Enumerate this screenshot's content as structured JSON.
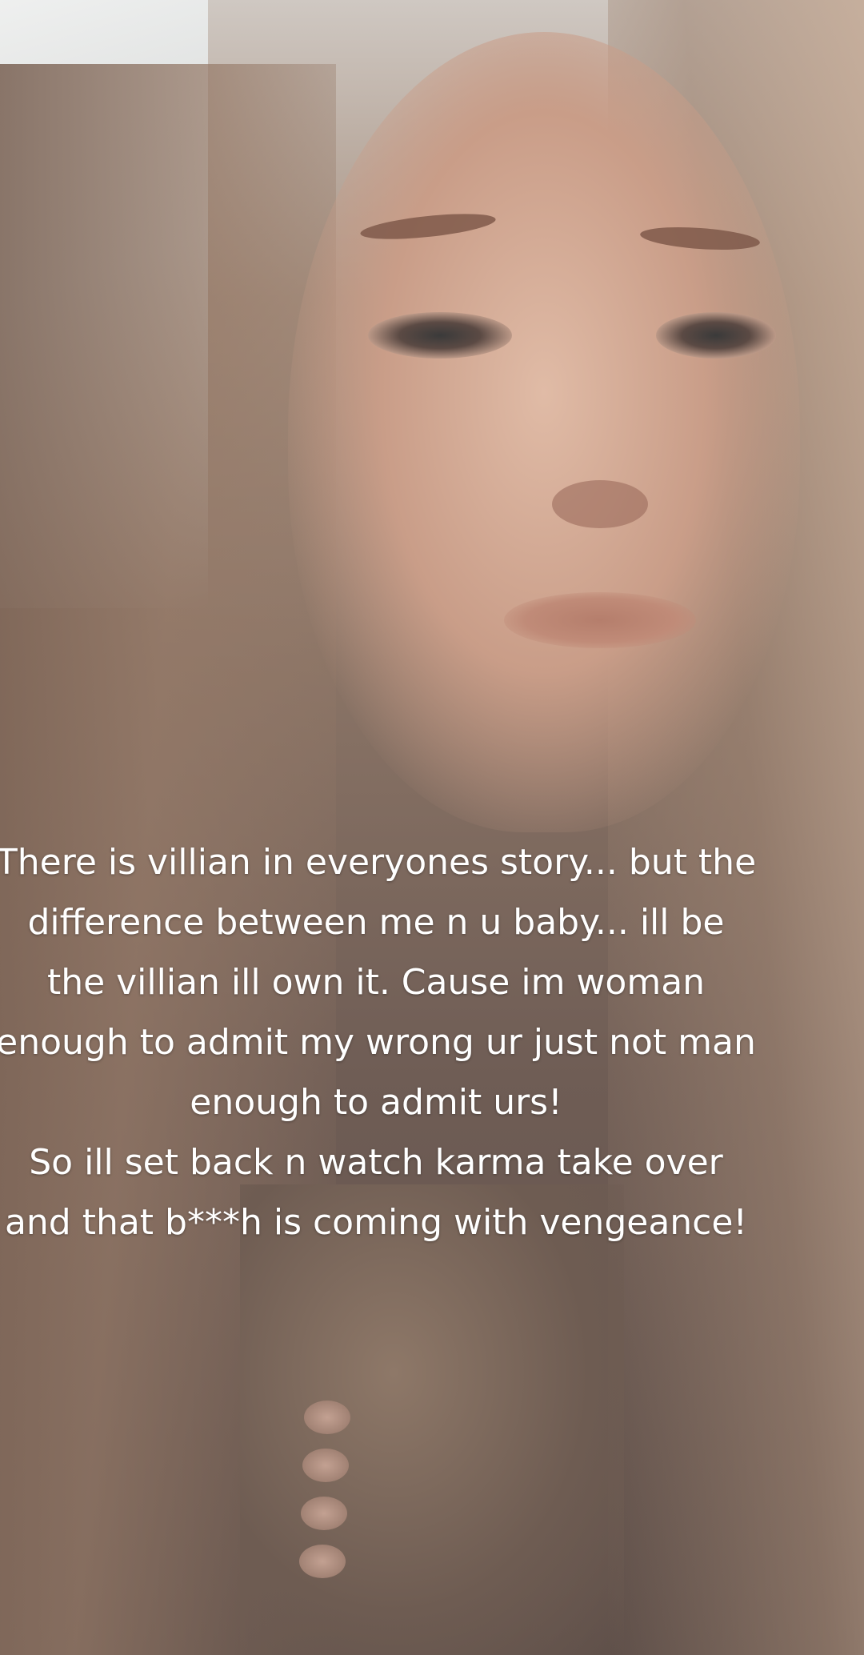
{
  "caption": {
    "lines": [
      "There is villian in everyones story... but the",
      "difference between me n u baby... ill be",
      "the villian ill own it. Cause im woman",
      "enough to admit my wrong ur just not man",
      "enough to admit urs!",
      "So ill set back n watch karma take over",
      "and that b***h is coming with vengeance!"
    ]
  }
}
